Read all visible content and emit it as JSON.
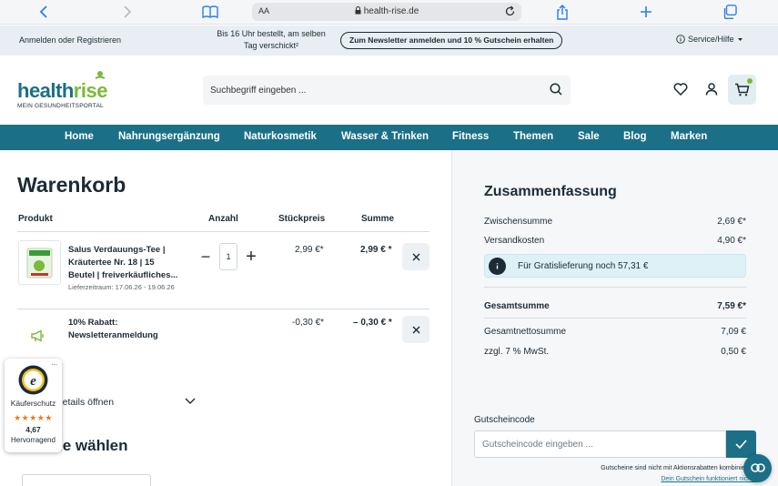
{
  "browser": {
    "reader_aa": "AA",
    "url": "health-rise.de"
  },
  "infobar": {
    "login": "Anmelden oder Registrieren",
    "shipping_line1": "Bis 16 Uhr bestellt, am selben",
    "shipping_line2": "Tag verschickt²",
    "newsletter_button": "Zum Newsletter anmelden und 10 % Gutschein erhalten",
    "service": "Service/Hilfe"
  },
  "header": {
    "logo_part1": "health",
    "logo_part2": "rise",
    "logo_tagline": "MEIN GESUNDHEITSPORTAL",
    "search_placeholder": "Suchbegriff eingeben ..."
  },
  "nav": {
    "items": [
      "Home",
      "Nahrungsergänzung",
      "Naturkosmetik",
      "Wasser & Trinken",
      "Fitness",
      "Themen",
      "Sale",
      "Blog",
      "Marken"
    ]
  },
  "cart": {
    "title": "Warenkorb",
    "columns": {
      "product": "Produkt",
      "quantity": "Anzahl",
      "unit_price": "Stückpreis",
      "total": "Summe"
    },
    "item": {
      "name": "Salus Verdauungs-Tee | Kräutertee Nr. 18 | 15 Beutel | freiverkäufliches...",
      "delivery": "Lieferzeitraum: 17.06.26 - 19.06.26",
      "quantity": "1",
      "unit_price": "2,99 €*",
      "total": "2,99 € *"
    },
    "discount": {
      "name": "10% Rabatt: Newsletteranmeldung",
      "unit_price": "-0,30 €*",
      "total": "– 0,30 € *"
    },
    "details_link": "ddetails öffnen",
    "section_title": "ie wählen"
  },
  "trusted": {
    "more": "...",
    "label": "Käuferschutz",
    "stars": "★★★★★",
    "score": "4,67",
    "rating": "Hervorragend"
  },
  "summary": {
    "title": "Zusammenfassung",
    "subtotal_label": "Zwischensumme",
    "subtotal_value": "2,69 €*",
    "shipping_label": "Versandkosten",
    "shipping_value": "4,90 €*",
    "free_shipping": "Für Gratislieferung noch 57,31 €",
    "total_label": "Gesamtsumme",
    "total_value": "7,59 €*",
    "net_label": "Gesamtnettosumme",
    "net_value": "7,09 €",
    "vat_label": "zzgl. 7 % MwSt.",
    "vat_value": "0,50 €"
  },
  "voucher": {
    "label": "Gutscheincode",
    "placeholder": "Gutscheincode eingeben ...",
    "note": "Gutscheine sind nicht mit Aktionsrabatten kombinierbar",
    "link": "Dein Gutschein funktioniert nicht?"
  },
  "colors": {
    "brand_teal": "#1b6f86",
    "brand_green": "#7bb93a",
    "text_dark": "#1c2b36",
    "rating_orange": "#e97b1e"
  },
  "icons": [
    "back-icon",
    "forward-icon",
    "bookmarks-icon",
    "lock-icon",
    "reload-icon",
    "share-icon",
    "new-tab-icon",
    "tabs-icon",
    "info-icon",
    "chevron-down-icon",
    "search-icon",
    "heart-icon",
    "user-icon",
    "cart-icon",
    "close-icon",
    "megaphone-icon",
    "check-icon",
    "chat-icon"
  ]
}
